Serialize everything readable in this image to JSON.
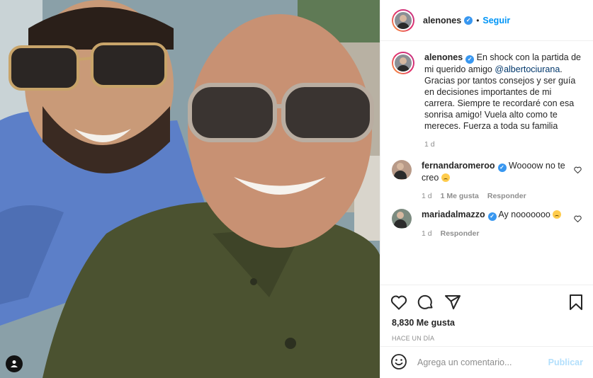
{
  "post": {
    "author": "alenones",
    "dot": "•",
    "follow_label": "Seguir"
  },
  "caption": {
    "username": "alenones",
    "text_before": "En shock con la partida de mi querido amigo",
    "mention": "@albertociurana",
    "text_after": ". Gracias por tantos consejos y ser guía en decisiones importantes de mi carrera. Siempre te recordaré con esa sonrisa amigo! Vuela alto como te mereces. Fuerza a toda su familia",
    "age": "1 d"
  },
  "comments": [
    {
      "username": "fernandaromeroo",
      "text": "Woooow no te creo",
      "age": "1 d",
      "likes": "1 Me gusta",
      "reply": "Responder"
    },
    {
      "username": "mariadalmazzo",
      "text": "Ay nooooooo",
      "age": "1 d",
      "reply": "Responder"
    }
  ],
  "stats": {
    "likes": "8,830 Me gusta",
    "time": "HACE UN DÍA"
  },
  "composer": {
    "placeholder": "Agrega un comentario...",
    "publish_label": "Publicar"
  },
  "icons": {
    "emoji": "smiley-icon",
    "like": "heart-icon",
    "comment": "comment-icon",
    "share": "paper-plane-icon",
    "save": "bookmark-icon",
    "tag": "user-tag-icon"
  },
  "colors": {
    "accent": "#0095f6",
    "verified": "#3897f0",
    "muted": "#8e8e8e",
    "border": "#efefef"
  }
}
